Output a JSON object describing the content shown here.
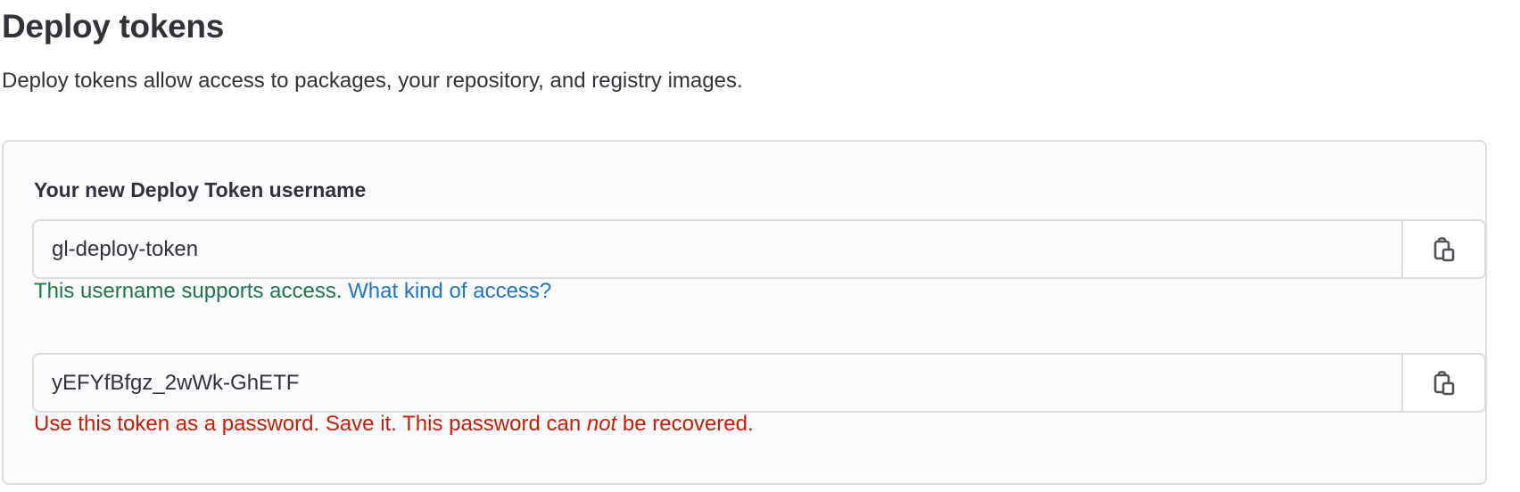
{
  "section": {
    "title": "Deploy tokens",
    "description": "Deploy tokens allow access to packages, your repository, and registry images."
  },
  "panel": {
    "username_label": "Your new Deploy Token username",
    "username_value": "gl-deploy-token",
    "username_help": "This username supports access.",
    "username_help_link": "What kind of access?",
    "token_value": "yEFYfBfgz_2wWk-GhETF",
    "token_help_before": "Use this token as a password. Save it. This password can",
    "token_help_emphasis": "not",
    "token_help_after": "be recovered.",
    "copy_icon": "copy-to-clipboard-icon"
  },
  "colors": {
    "success_text": "#217645",
    "link_text": "#1f75cb",
    "danger_text": "#c91c00",
    "panel_background": "#fbfafd",
    "border": "#dcdcde"
  }
}
